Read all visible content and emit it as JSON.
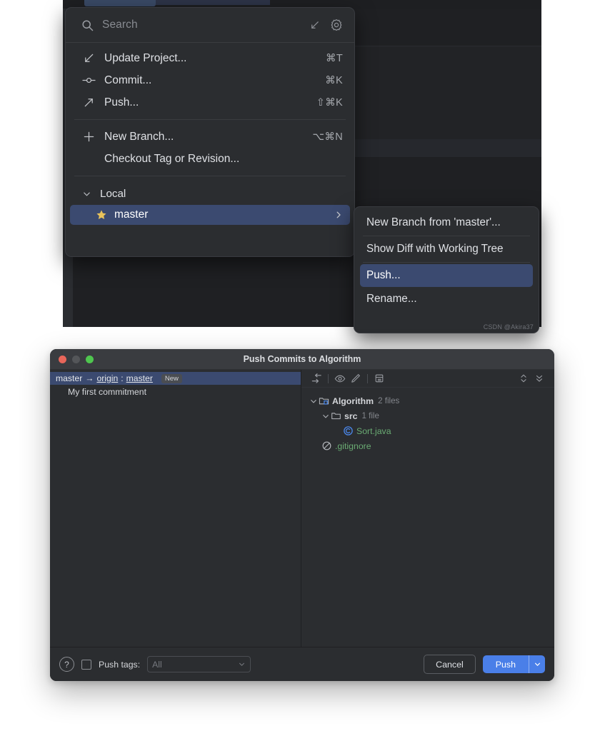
{
  "ide": {
    "background_color": "#1e1f22"
  },
  "branch_popup": {
    "search": {
      "placeholder": "Search",
      "icon": "search-icon",
      "expand_icon": "diagonal-arrow-icon",
      "settings_icon": "gear-icon"
    },
    "actions": [
      {
        "icon": "update-project-icon",
        "label": "Update Project...",
        "shortcut": "⌘T"
      },
      {
        "icon": "commit-icon",
        "label": "Commit...",
        "shortcut": "⌘K"
      },
      {
        "icon": "push-arrow-icon",
        "label": "Push...",
        "shortcut": "⇧⌘K"
      }
    ],
    "branch_actions": [
      {
        "icon": "plus-icon",
        "label": "New Branch...",
        "shortcut": "⌥⌘N"
      },
      {
        "icon": "",
        "label": "Checkout Tag or Revision...",
        "shortcut": ""
      }
    ],
    "local_group": {
      "label": "Local",
      "expanded": true,
      "branches": [
        {
          "name": "master",
          "favorite": true,
          "selected": true,
          "has_submenu": true
        }
      ]
    }
  },
  "branch_submenu": {
    "items": [
      {
        "label": "New Branch from 'master'...",
        "selected": false
      },
      {
        "label": "Show Diff with Working Tree",
        "selected": false
      },
      {
        "label": "Push...",
        "selected": true
      },
      {
        "label": "Rename...",
        "selected": false
      }
    ],
    "watermark": "CSDN @Akira37"
  },
  "push_dialog": {
    "title": "Push Commits to Algorithm",
    "window_controls": [
      "close",
      "minimize",
      "zoom"
    ],
    "commits_pane": {
      "push_spec": {
        "source_branch": "master",
        "arrow": "→",
        "remote": "origin",
        "separator": ":",
        "target_branch": "master",
        "badge": "New"
      },
      "commits": [
        {
          "message": "My first commitment"
        }
      ]
    },
    "files_pane": {
      "toolbar_icons": [
        "collapse-arrow-icon",
        "preview-eye-icon",
        "edit-pencil-icon",
        "group-by-icon",
        "expand-collapse-icon",
        "collapse-all-icon"
      ],
      "tree": [
        {
          "depth": 0,
          "icon": "module-folder-icon",
          "name": "Algorithm",
          "count": "2 files",
          "expanded": true,
          "color": "default",
          "bold": true
        },
        {
          "depth": 1,
          "icon": "folder-icon",
          "name": "src",
          "count": "1 file",
          "expanded": true,
          "color": "default",
          "bold": true
        },
        {
          "depth": 2,
          "icon": "java-class-icon",
          "name": "Sort.java",
          "count": "",
          "expanded": null,
          "color": "green",
          "bold": false
        },
        {
          "depth": 1,
          "icon": "gitignore-icon",
          "name": ".gitignore",
          "count": "",
          "expanded": null,
          "color": "green",
          "bold": false
        }
      ]
    },
    "footer": {
      "help_label": "?",
      "push_tags_label": "Push tags:",
      "push_tags_checked": false,
      "tags_select_value": "All",
      "cancel_label": "Cancel",
      "push_label": "Push",
      "push_dropdown_icon": "chevron-down-icon",
      "accent_color": "#4a7fe8"
    }
  }
}
